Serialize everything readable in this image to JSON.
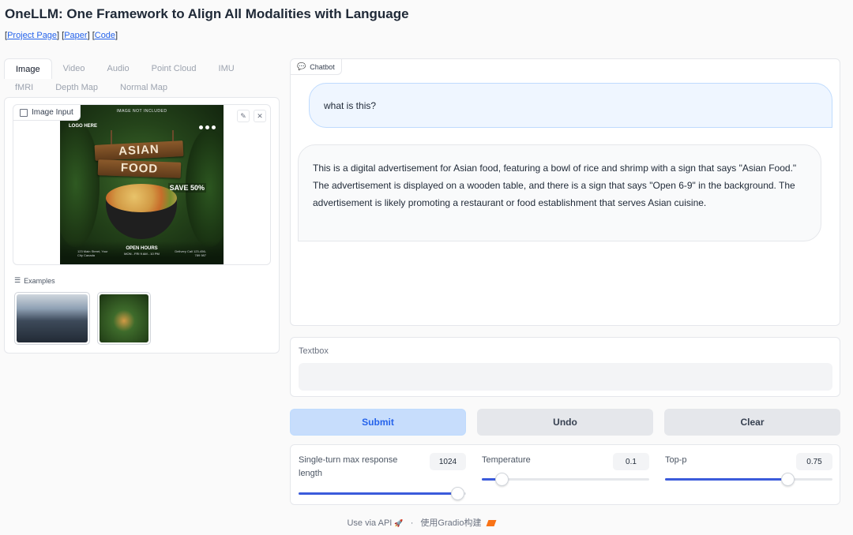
{
  "header": {
    "title": "OneLLM: One Framework to Align All Modalities with Language",
    "links": [
      "Project Page",
      "Paper",
      "Code"
    ]
  },
  "tabs": {
    "row1": [
      "Image",
      "Video",
      "Audio",
      "Point Cloud",
      "IMU"
    ],
    "row2": [
      "fMRI",
      "Depth Map",
      "Normal Map"
    ],
    "active": "Image"
  },
  "image_input": {
    "label": "Image Input",
    "edit_icon": "pencil-icon",
    "clear_icon": "close-icon"
  },
  "poster": {
    "top_text": "IMAGE NOT INCLUDED",
    "logo": "LOGO HERE",
    "sign_line1": "ASIAN",
    "sign_line2": "FOOD",
    "badge": "SAVE 50%",
    "open_hours": "OPEN HOURS",
    "hours_detail": "MON - FRI 9 AM - 10 PM",
    "address": "123 Main Street, Your City Canada",
    "delivery": "Delivery Call 123-456-789 987"
  },
  "examples": {
    "label": "Examples"
  },
  "chatbot": {
    "label": "Chatbot",
    "user_message": "what is this?",
    "bot_message": "This is a digital advertisement for Asian food, featuring a bowl of rice and shrimp with a sign that says \"Asian Food.\" The advertisement is displayed on a wooden table, and there is a sign that says \"Open 6-9\" in the background. The advertisement is likely promoting a restaurant or food establishment that serves Asian cuisine."
  },
  "textbox": {
    "label": "Textbox",
    "value": ""
  },
  "buttons": {
    "submit": "Submit",
    "undo": "Undo",
    "clear": "Clear"
  },
  "sliders": [
    {
      "label": "Single-turn max response length",
      "value": "1024",
      "fraction": 0.95
    },
    {
      "label": "Temperature",
      "value": "0.1",
      "fraction": 0.12
    },
    {
      "label": "Top-p",
      "value": "0.75",
      "fraction": 0.73
    }
  ],
  "footer": {
    "api": "Use via API",
    "built": "使用Gradio构建"
  },
  "colors": {
    "accent": "#3b5bdb",
    "submit_bg": "#c7ddfc",
    "user_bubble": "#eff6ff"
  }
}
